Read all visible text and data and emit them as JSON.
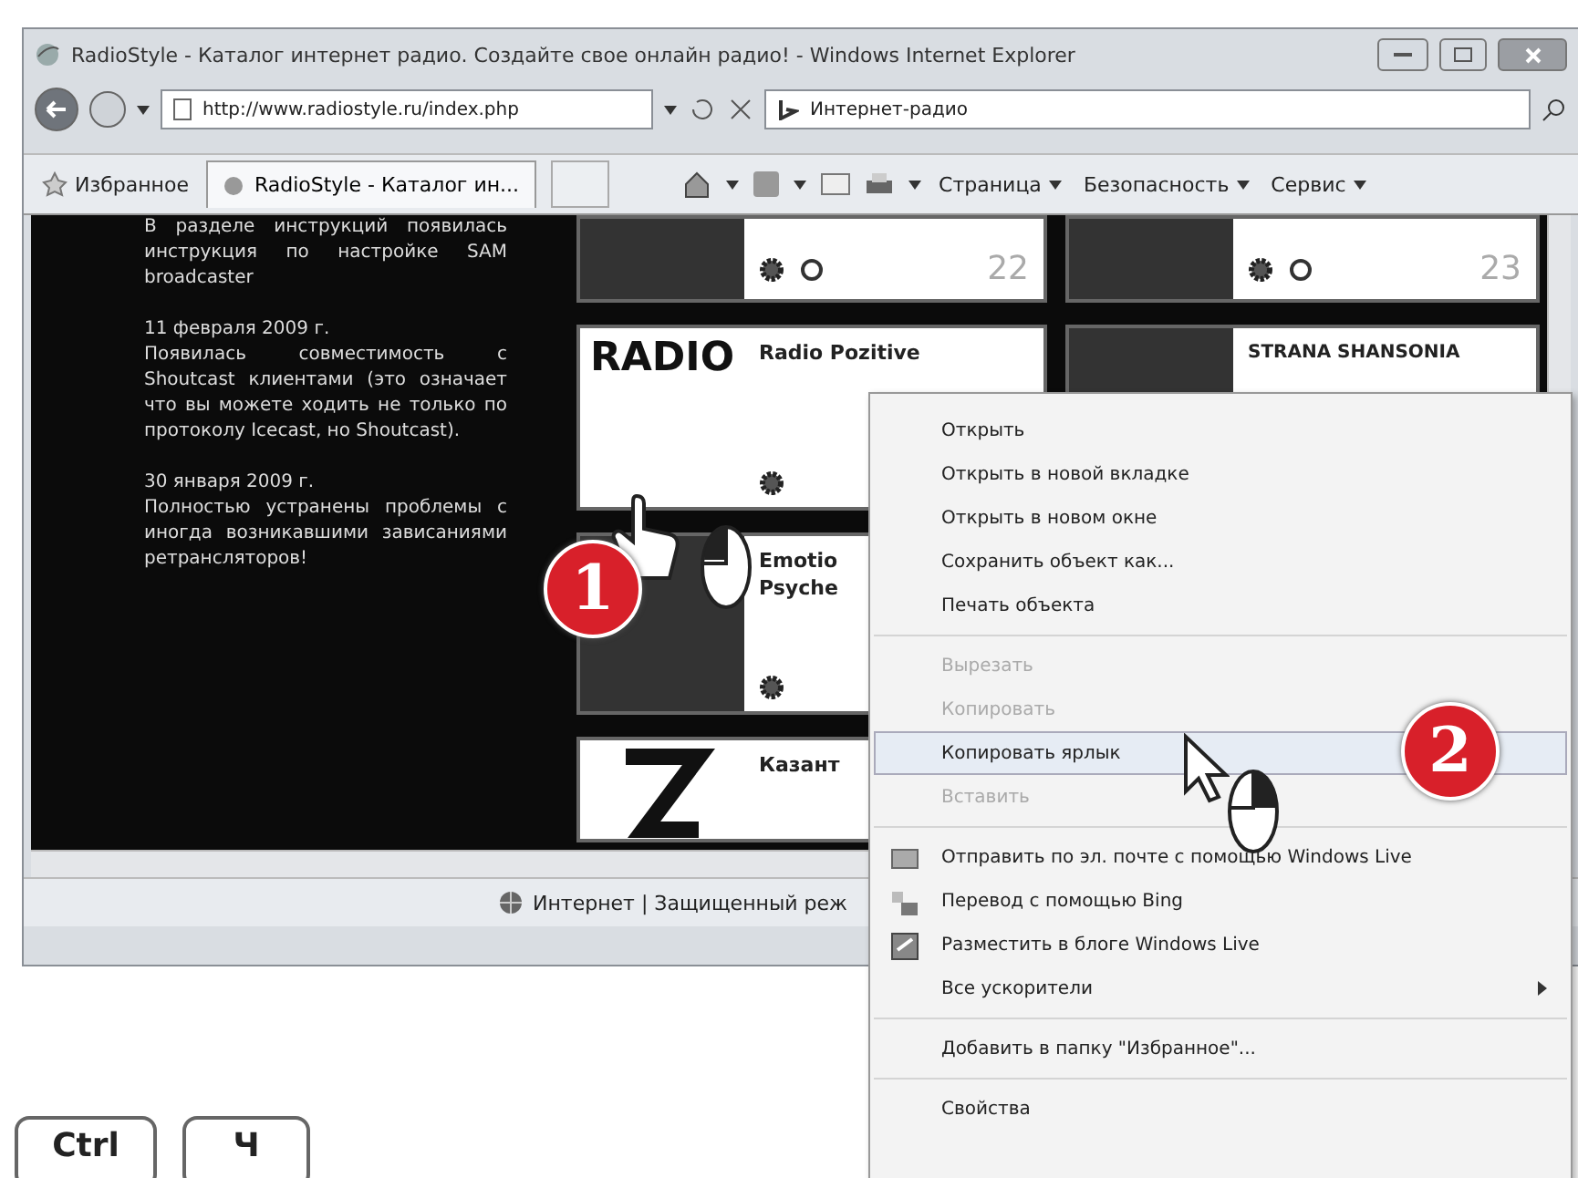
{
  "window": {
    "title": "RadioStyle - Каталог интернет радио. Создайте свое онлайн радио! - Windows Internet Explorer"
  },
  "address_bar": {
    "url": "http://www.radiostyle.ru/index.php"
  },
  "search": {
    "value": "Интернет-радио"
  },
  "favorites": "Избранное",
  "tabs": [
    {
      "label": "RadioStyle - Каталог ин...",
      "selected": true
    }
  ],
  "command_menus": [
    "Страница",
    "Безопасность",
    "Сервис"
  ],
  "news": [
    {
      "text": "В разделе инструкций появилась инструкция по настройке SAM broadcaster"
    },
    {
      "date": "11 февраля 2009 г.",
      "text": "Появилась совместимость с Shoutcast клиентами (это означает что вы можете ходить не только по протоколу Icecast, но Shoutcast)."
    },
    {
      "date": "30 января 2009 г.",
      "text": "Полностью устранены проблемы с иногда возникавшими зависаниями ретрансляторов!"
    }
  ],
  "stations": [
    {
      "kind": "top",
      "number": "22"
    },
    {
      "kind": "top",
      "number": "23"
    },
    {
      "kind": "full",
      "logo_text": "RADIO",
      "name": "Radio Pozitive"
    },
    {
      "kind": "logo",
      "logo_text": "STRANA SHANSONIA"
    },
    {
      "kind": "full",
      "name": "Emotio Psyche"
    },
    {
      "kind": "empty"
    },
    {
      "kind": "short",
      "name": "Казант"
    },
    {
      "kind": "empty"
    }
  ],
  "status_bar": {
    "zone": "Интернет | Защищенный реж"
  },
  "context_menu": [
    [
      {
        "label": "Открыть",
        "kind": "plain",
        "disabled": false,
        "selected": false,
        "submenu": false
      },
      {
        "label": "Открыть в новой вкладке",
        "kind": "plain",
        "disabled": false,
        "selected": false,
        "submenu": false
      },
      {
        "label": "Открыть в новом окне",
        "kind": "plain",
        "disabled": false,
        "selected": false,
        "submenu": false
      },
      {
        "label": "Сохранить объект как...",
        "kind": "plain",
        "disabled": false,
        "selected": false,
        "submenu": false
      },
      {
        "label": "Печать объекта",
        "kind": "plain",
        "disabled": false,
        "selected": false,
        "submenu": false
      }
    ],
    [
      {
        "label": "Вырезать",
        "kind": "plain",
        "disabled": true,
        "selected": false,
        "submenu": false
      },
      {
        "label": "Копировать",
        "kind": "plain",
        "disabled": true,
        "selected": false,
        "submenu": false
      },
      {
        "label": "Копировать ярлык",
        "kind": "plain",
        "disabled": false,
        "selected": true,
        "submenu": false
      },
      {
        "label": "Вставить",
        "kind": "plain",
        "disabled": true,
        "selected": false,
        "submenu": false
      }
    ],
    [
      {
        "label": "Отправить по эл. почте с помощью Windows Live",
        "kind": "accelerator",
        "disabled": false,
        "selected": false,
        "submenu": false
      },
      {
        "label": "Перевод с помощью Bing",
        "kind": "accelerator",
        "disabled": false,
        "selected": false,
        "submenu": false
      },
      {
        "label": "Разместить в блоге Windows Live",
        "kind": "accelerator",
        "disabled": false,
        "selected": false,
        "submenu": false
      },
      {
        "label": "Все ускорители",
        "kind": "plain",
        "disabled": false,
        "selected": false,
        "submenu": true
      }
    ],
    [
      {
        "label": "Добавить в папку \"Избранное\"...",
        "kind": "plain",
        "disabled": false,
        "selected": false,
        "submenu": false
      }
    ],
    [
      {
        "label": "Свойства",
        "kind": "plain",
        "disabled": false,
        "selected": false,
        "submenu": false
      }
    ]
  ],
  "badges": [
    "1",
    "2"
  ],
  "keys": [
    "Ctrl",
    "Ч"
  ]
}
